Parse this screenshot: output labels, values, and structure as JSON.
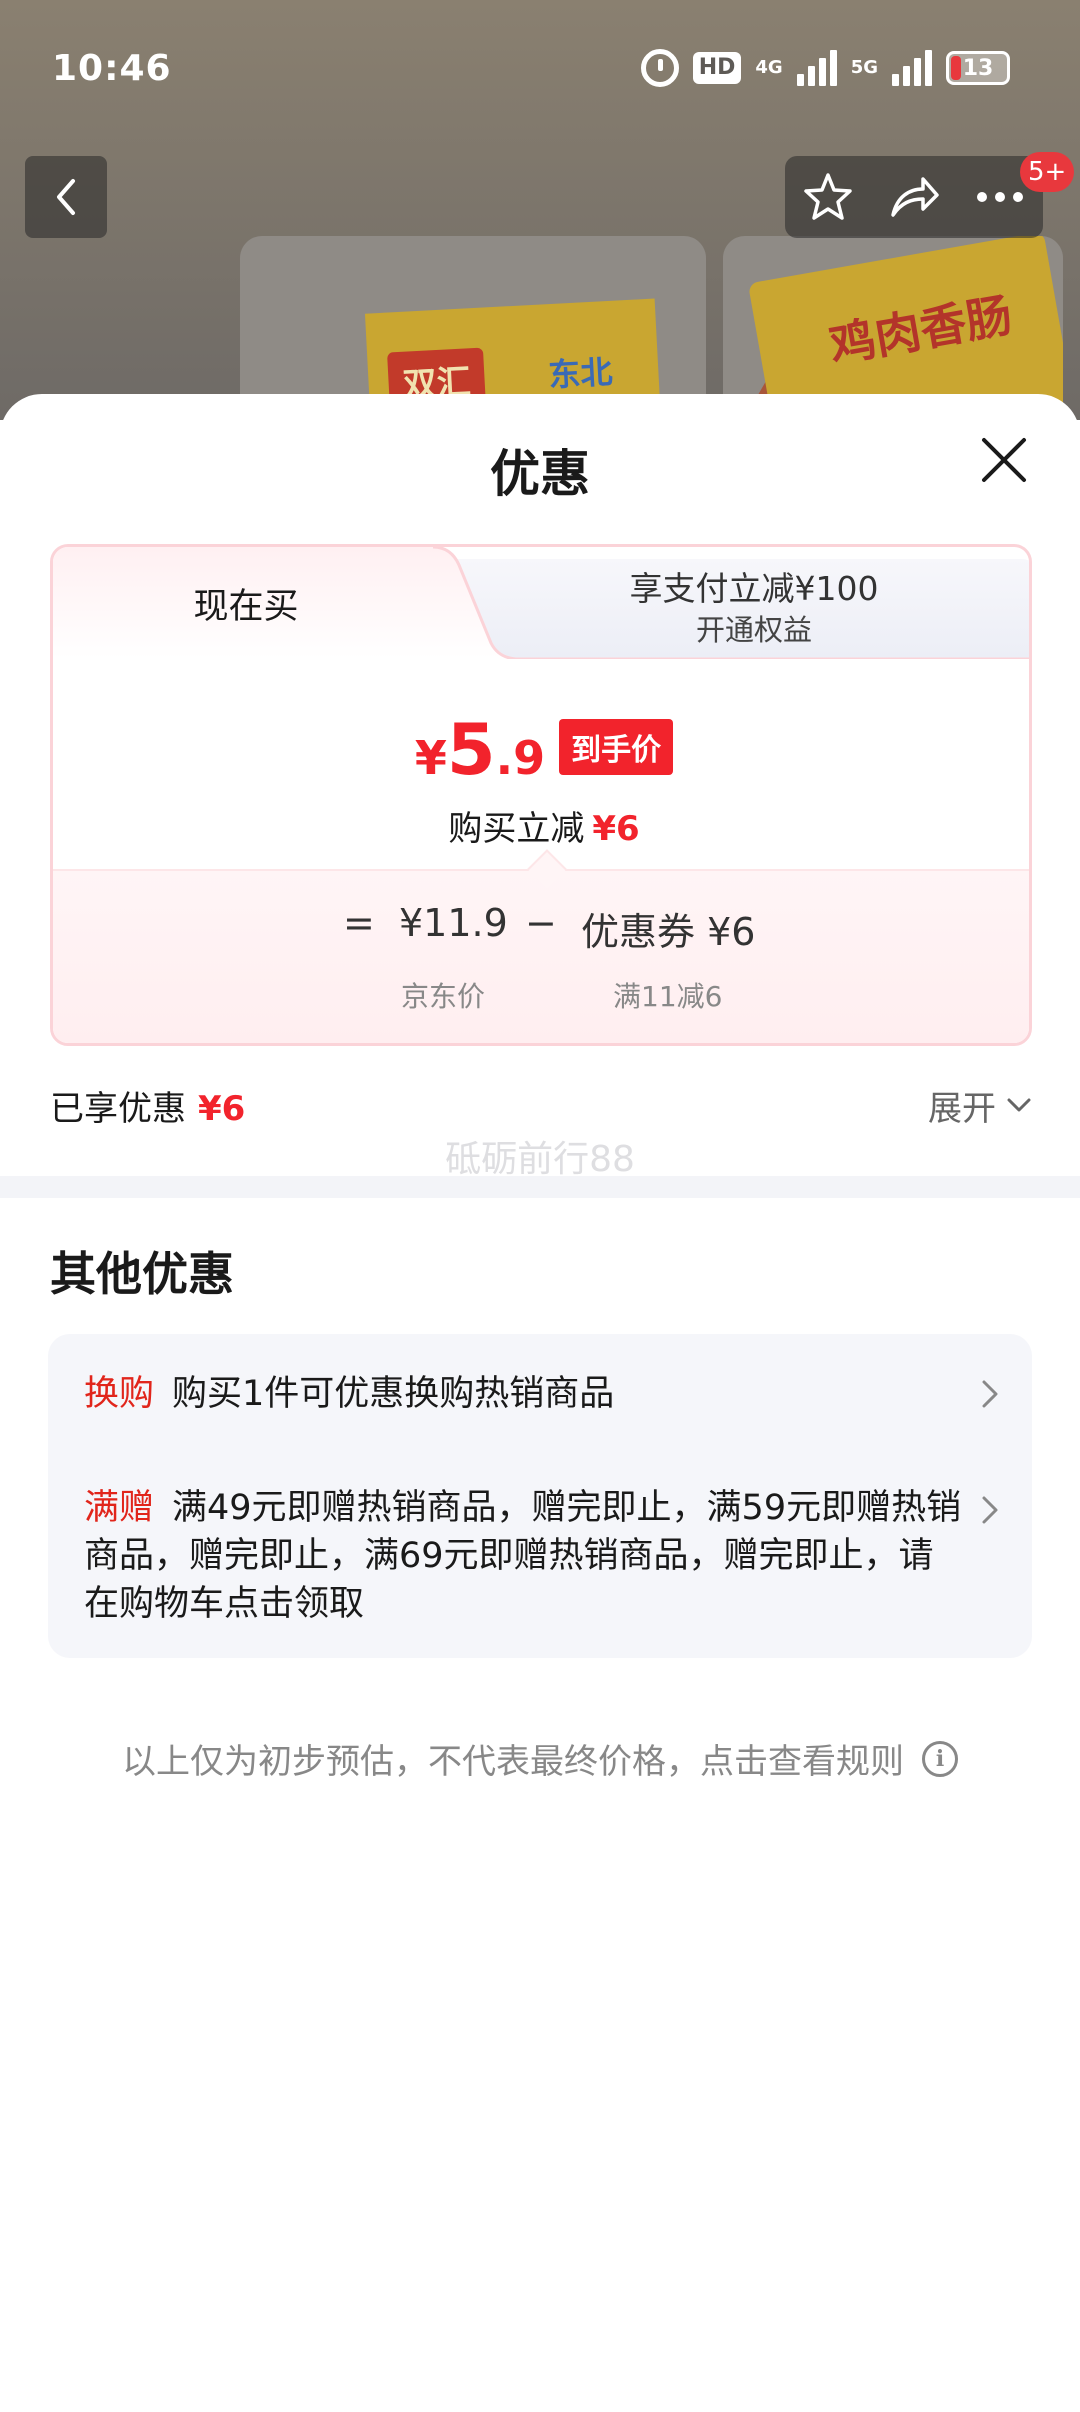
{
  "status_bar": {
    "time": "10:46",
    "hd_label": "HD",
    "net1": "4G",
    "net2": "5G",
    "battery": "13"
  },
  "top_bar": {
    "cart_badge": "5+"
  },
  "background_products": [
    {
      "brand1": "双汇",
      "brand2": "东北"
    },
    {
      "title": "鸡肉香肠"
    }
  ],
  "sheet": {
    "title": "优惠"
  },
  "tabs": {
    "active": "现在买",
    "inactive_main": "享支付立减¥100",
    "inactive_sub": "开通权益"
  },
  "price": {
    "yen": "¥",
    "int": "5",
    "dec": ".9",
    "tag": "到手价",
    "reduce_label": "购买立减",
    "reduce_amount": "¥6"
  },
  "formula": {
    "equals": "=",
    "base_price": "¥11.9",
    "minus": "−",
    "coupon": "优惠券 ¥6",
    "base_label": "京东价",
    "coupon_label": "满11减6"
  },
  "enjoyed": {
    "label": "已享优惠",
    "amount": "¥6",
    "expand": "展开"
  },
  "watermark": "砥砺前行88",
  "other": {
    "title": "其他优惠",
    "items": [
      {
        "label": "换购",
        "text": "购买1件可优惠换购热销商品"
      },
      {
        "label": "满赠",
        "text": "满49元即赠热销商品，赠完即止，满59元即赠热销商品，赠完即止，满69元即赠热销商品，赠完即止，请在购物车点击领取"
      }
    ]
  },
  "footnote": "以上仅为初步预估，不代表最终价格，点击查看规则",
  "colors": {
    "accent_red": "#f2232c",
    "promo_red": "#e1251b",
    "card_border": "#fbd3d8",
    "badge_red": "#e8383d"
  }
}
